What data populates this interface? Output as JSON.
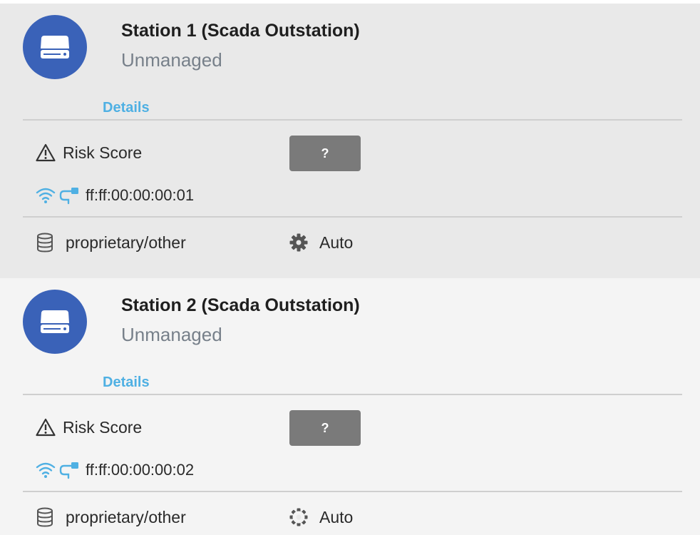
{
  "colors": {
    "avatar_bg": "#3a62b8",
    "link": "#4fb0e3",
    "button_bg": "#7a7a7a",
    "connection_icon": "#4fb0e3"
  },
  "devices": [
    {
      "name": "Station 1 (Scada Outstation)",
      "status": "Unmanaged",
      "details_label": "Details",
      "risk_label": "Risk Score",
      "risk_value": "?",
      "mac": "ff:ff:00:00:00:01",
      "protocol": "proprietary/other",
      "mode": "Auto",
      "icons": {
        "avatar": "server-icon",
        "risk": "warning-icon",
        "wireless": "wifi-icon",
        "wired": "ethernet-icon",
        "protocol": "database-icon",
        "mode": "gear-icon"
      }
    },
    {
      "name": "Station 2 (Scada Outstation)",
      "status": "Unmanaged",
      "details_label": "Details",
      "risk_label": "Risk Score",
      "risk_value": "?",
      "mac": "ff:ff:00:00:00:02",
      "protocol": "proprietary/other",
      "mode": "Auto",
      "icons": {
        "avatar": "server-icon",
        "risk": "warning-icon",
        "wireless": "wifi-icon",
        "wired": "ethernet-icon",
        "protocol": "database-icon",
        "mode": "gear-icon"
      }
    }
  ]
}
